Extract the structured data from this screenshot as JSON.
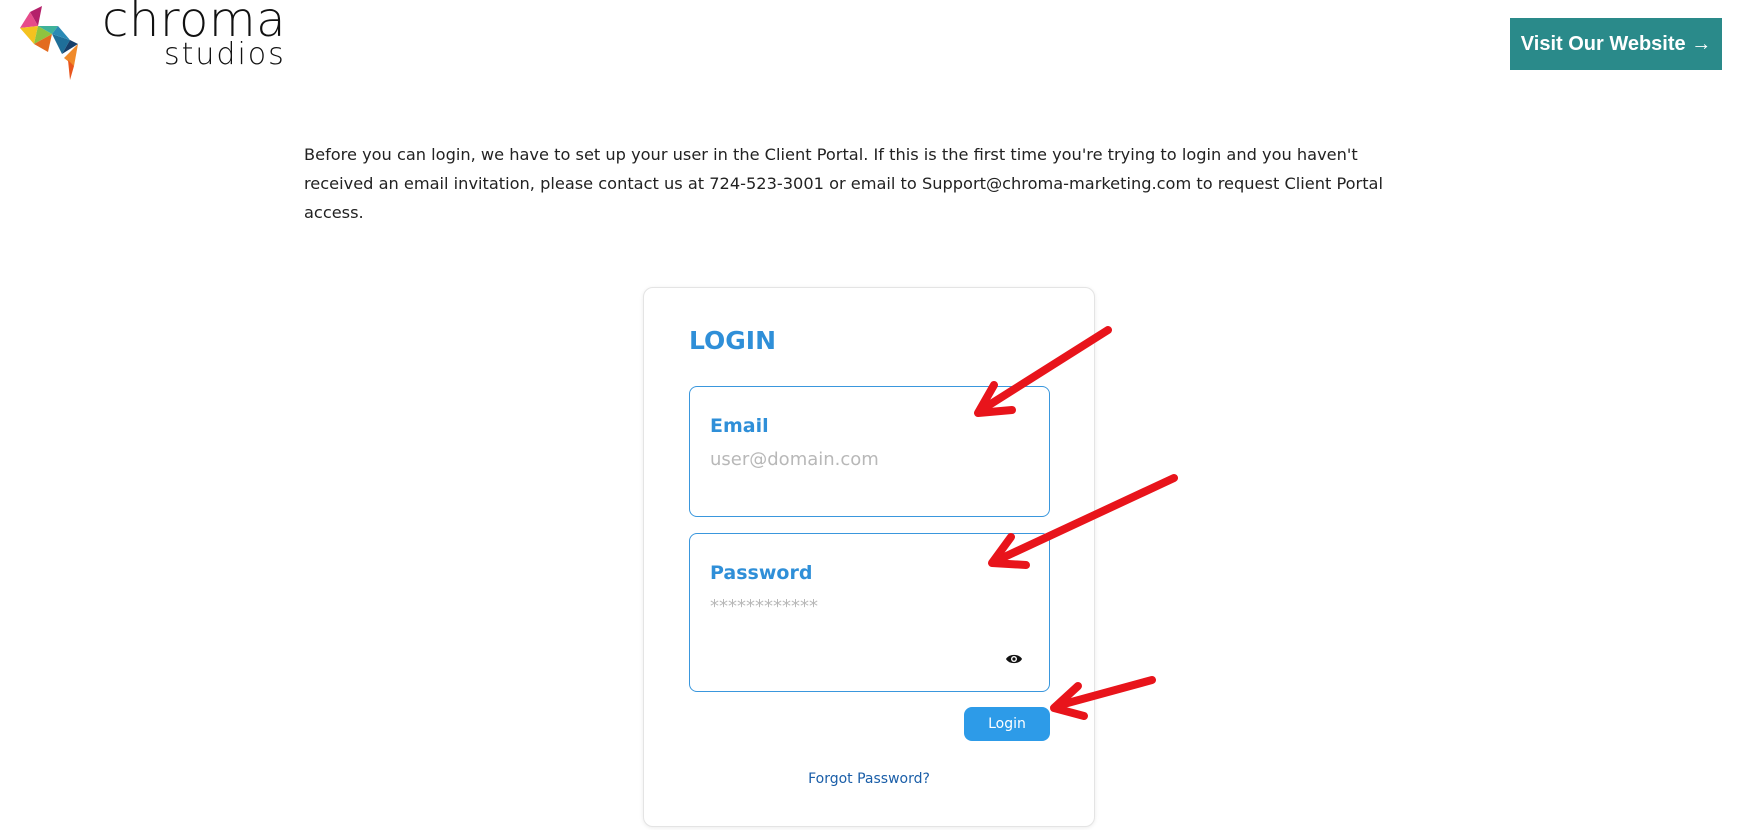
{
  "header": {
    "logo": {
      "line1": "chroma",
      "line2": "studios"
    },
    "visit_button_label": "Visit Our Website →"
  },
  "notice": {
    "text": "Before you can login, we have to set up your user in the Client Portal. If this is the first time you're trying to login and you haven't received an email invitation, please contact us at 724-523-3001 or email to Support@chroma-marketing.com to request Client Portal access."
  },
  "login": {
    "title": "LOGIN",
    "email_label": "Email",
    "email_placeholder": "user@domain.com",
    "password_label": "Password",
    "password_placeholder": "************",
    "submit_label": "Login",
    "forgot_label": "Forgot Password?"
  },
  "colors": {
    "accent_blue": "#2f8fd8",
    "button_blue": "#2d9be8",
    "teal_button": "#2a8a8a",
    "annotation_red": "#e8141b"
  },
  "icons": {
    "password_toggle": "eye-icon",
    "annotations": "red-arrow-icon"
  }
}
